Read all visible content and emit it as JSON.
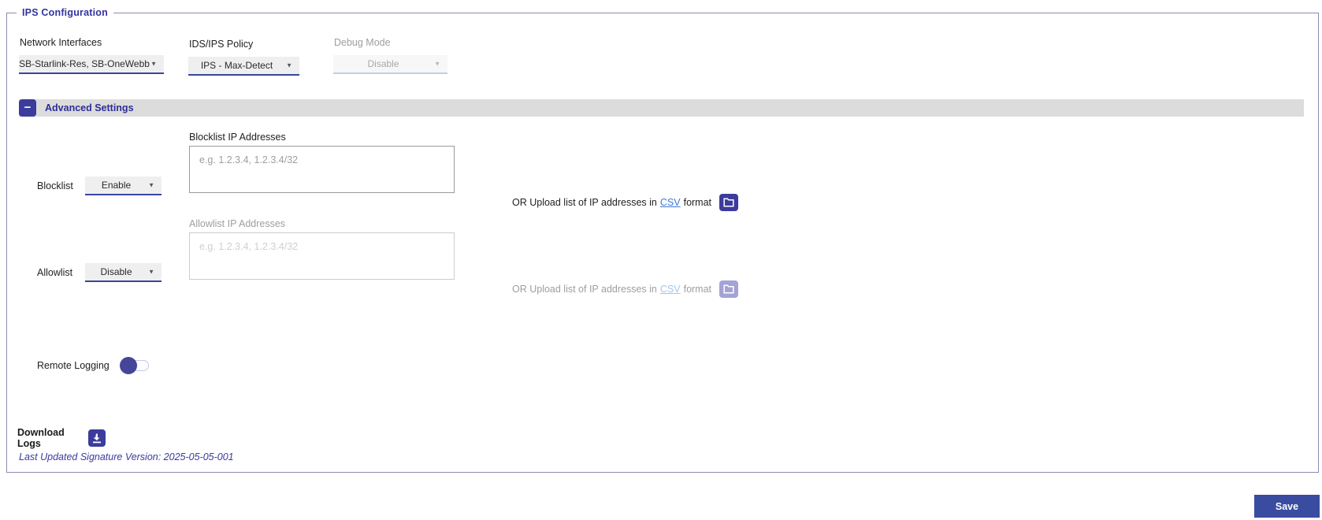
{
  "legend": "IPS Configuration",
  "icons": {
    "caret": "▼",
    "minus": "−"
  },
  "colors": {
    "accent_indigo": "#3C3C9C",
    "dropdown_underline": "#37479E",
    "advanced_bar_gray": "#DCDCDC",
    "link_blue": "#4178D2",
    "disabled_text_gray": "#9E9E9E",
    "save_button_blue": "#394CA0",
    "panel_border": "#8C8CB2"
  },
  "top": {
    "network_interfaces": {
      "label": "Network Interfaces",
      "value": "SB-Starlink-Res, SB-OneWebb"
    },
    "policy": {
      "label": "IDS/IPS Policy",
      "value": "IPS - Max-Detect"
    },
    "debug": {
      "label": "Debug Mode",
      "value": "Disable"
    }
  },
  "advanced": {
    "title": "Advanced Settings"
  },
  "blocklist": {
    "row_label": "Blocklist",
    "mode": "Enable",
    "textarea_label": "Blocklist IP Addresses",
    "placeholder": "e.g. 1.2.3.4, 1.2.3.4/32",
    "upload_prefix": "OR Upload list of IP addresses in",
    "csv_link": "CSV",
    "upload_suffix": "format"
  },
  "allowlist": {
    "row_label": "Allowlist",
    "mode": "Disable",
    "textarea_label": "Allowlist IP Addresses",
    "placeholder": "e.g. 1.2.3.4, 1.2.3.4/32",
    "upload_prefix": "OR Upload list of IP addresses in",
    "csv_link": "CSV",
    "upload_suffix": "format"
  },
  "remote_logging": {
    "label": "Remote Logging",
    "state": "off"
  },
  "download_logs": {
    "label": "Download Logs"
  },
  "signature": {
    "text": "Last Updated Signature Version: 2025-05-05-001"
  },
  "save": {
    "label": "Save"
  }
}
